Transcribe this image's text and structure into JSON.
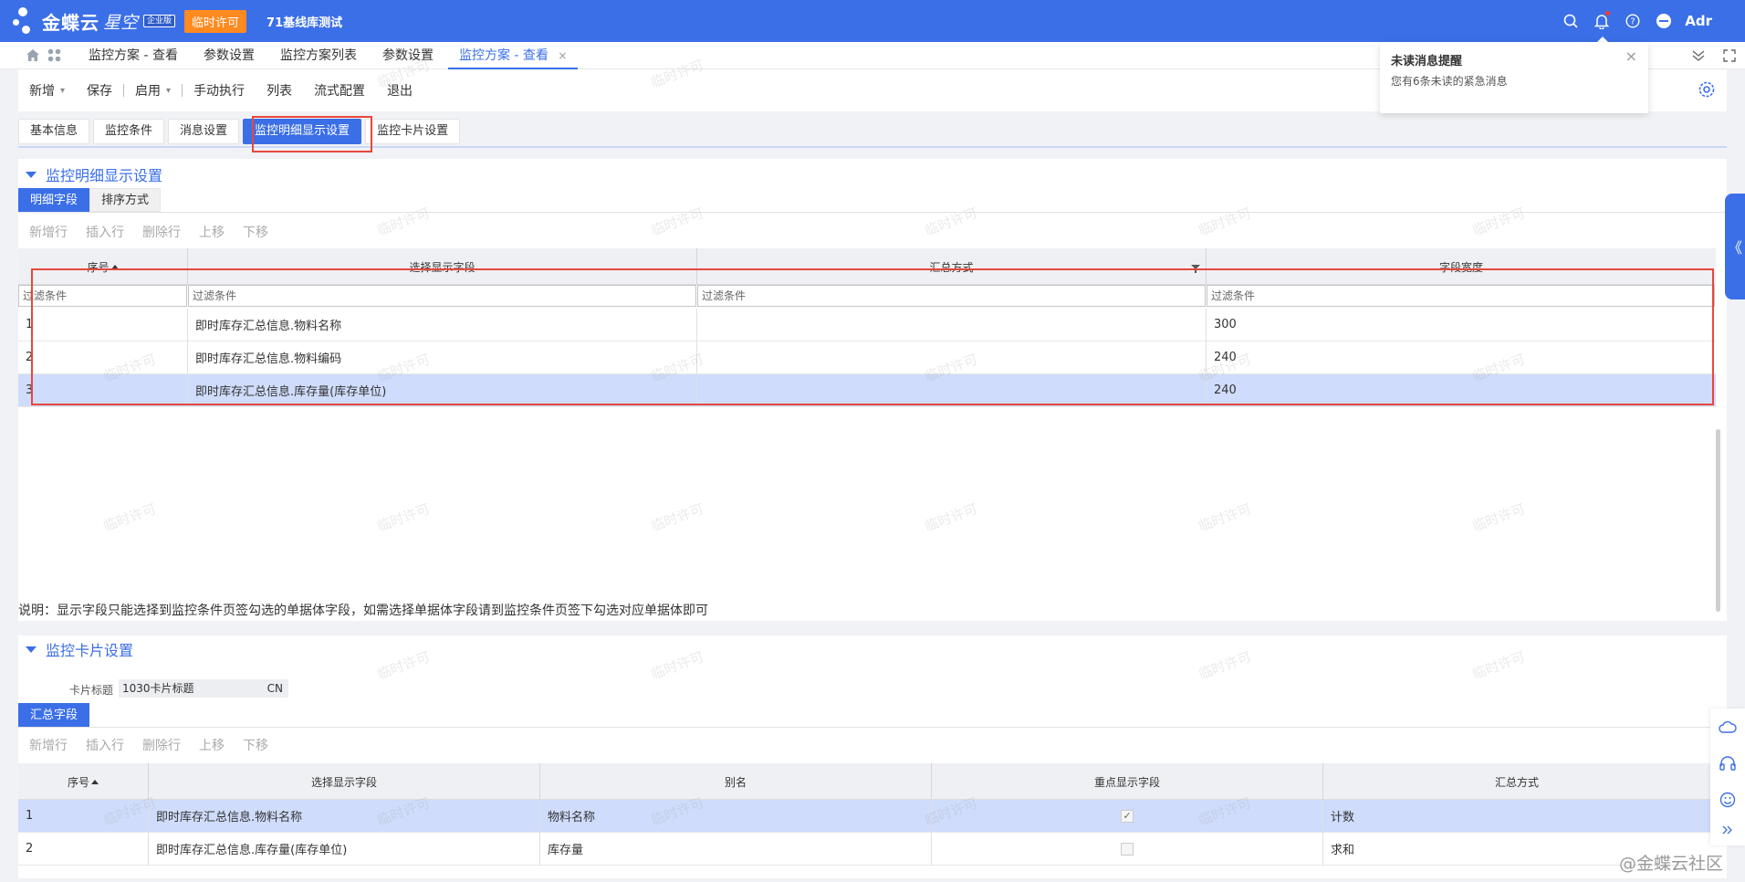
{
  "header": {
    "brand": "金蝶云",
    "brand_sub": "星空",
    "edition": "企业版",
    "license_button": "临时许可",
    "tenant": "71基线库测试",
    "user": "Adr",
    "accent": "#3b6fe7"
  },
  "page_tabs": [
    {
      "label": "监控方案 - 查看"
    },
    {
      "label": "参数设置"
    },
    {
      "label": "监控方案列表"
    },
    {
      "label": "参数设置"
    },
    {
      "label": "监控方案 - 查看",
      "close": "×"
    }
  ],
  "notification": {
    "title": "未读消息提醒",
    "body": "您有6条未读的紧急消息",
    "close": "×"
  },
  "toolbar": {
    "new": "新增",
    "save": "保存",
    "enable": "启用",
    "manual": "手动执行",
    "list": "列表",
    "flow": "流式配置",
    "exit": "退出"
  },
  "content_tabs": [
    "基本信息",
    "监控条件",
    "消息设置",
    "监控明细显示设置",
    "监控卡片设置"
  ],
  "detail_section": {
    "title": "监控明细显示设置",
    "subtabs": [
      "明细字段",
      "排序方式"
    ],
    "row_tools": [
      "新增行",
      "插入行",
      "删除行",
      "上移",
      "下移"
    ],
    "columns": [
      "序号",
      "选择显示字段",
      "汇总方式",
      "字段宽度"
    ],
    "filter_placeholder": "过滤条件",
    "rows": [
      {
        "seq": "1",
        "field": "即时库存汇总信息.物料名称",
        "summary": "",
        "width": "300"
      },
      {
        "seq": "2",
        "field": "即时库存汇总信息.物料编码",
        "summary": "",
        "width": "240"
      },
      {
        "seq": "3",
        "field": "即时库存汇总信息.库存量(库存单位)",
        "summary": "",
        "width": "240"
      }
    ],
    "note": "说明：显示字段只能选择到监控条件页签勾选的单据体字段，如需选择单据体字段请到监控条件页签下勾选对应单据体即可"
  },
  "card_section": {
    "title": "监控卡片设置",
    "card_title_label": "卡片标题",
    "card_title_value": "1030卡片标题",
    "card_title_lang": "CN",
    "subtab": "汇总字段",
    "row_tools": [
      "新增行",
      "插入行",
      "删除行",
      "上移",
      "下移"
    ],
    "columns": [
      "序号",
      "选择显示字段",
      "别名",
      "重点显示字段",
      "汇总方式"
    ],
    "rows": [
      {
        "seq": "1",
        "field": "即时库存汇总信息.物料名称",
        "alias": "物料名称",
        "highlight": "✓",
        "summary": "计数"
      },
      {
        "seq": "2",
        "field": "即时库存汇总信息.库存量(库存单位)",
        "alias": "库存量",
        "highlight": "",
        "summary": "求和"
      }
    ]
  },
  "watermark": "临时许可",
  "community": "@金蝶云社区",
  "side_collapse": "《"
}
